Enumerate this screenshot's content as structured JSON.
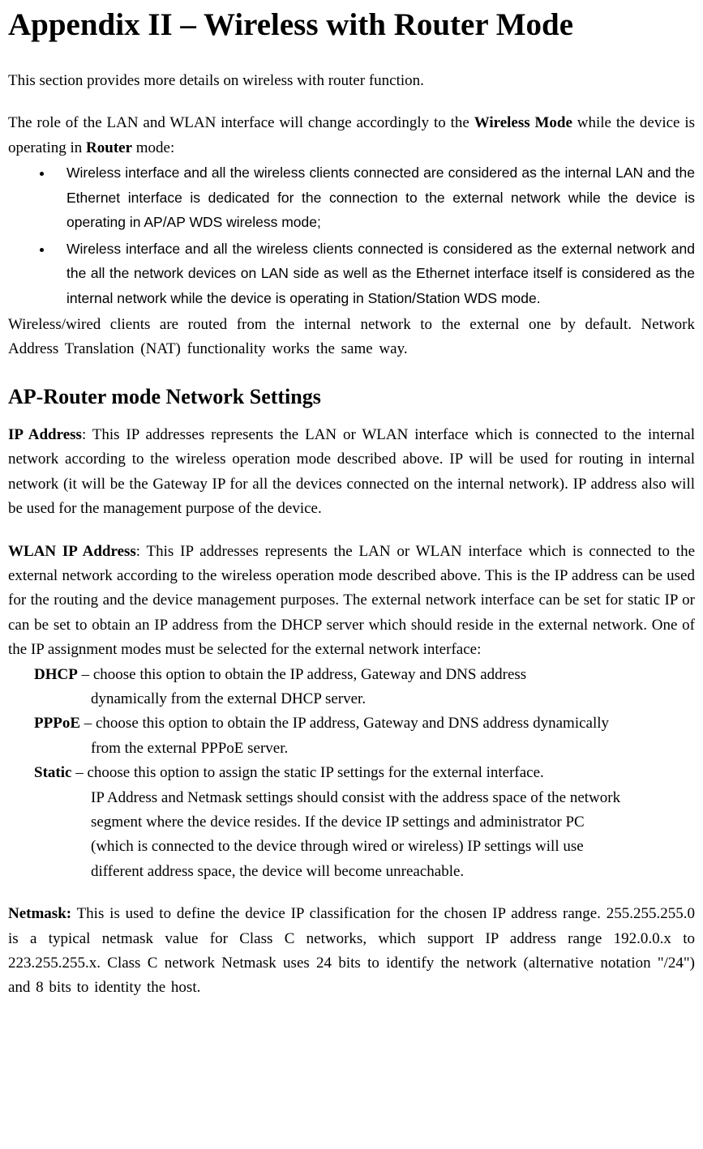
{
  "title": "Appendix II – Wireless with Router Mode",
  "intro": "This section provides more details on wireless with router function.",
  "role_p1_a": "The role of the LAN and WLAN interface will change accordingly to the ",
  "role_p1_bold1": "Wireless Mode",
  "role_p1_b": " while the device is operating in ",
  "role_p1_bold2": "Router",
  "role_p1_c": " mode:",
  "bullets": [
    "Wireless interface and all the wireless clients connected are considered as the internal LAN and the Ethernet interface is dedicated for the connection to the external network while the device is operating in AP/AP WDS wireless mode;",
    "Wireless interface and all the wireless clients connected is considered as the external network and the all the network devices on LAN side as well as the Ethernet interface itself is considered as the internal network while the device is operating in Station/Station WDS mode."
  ],
  "after_bullets": "Wireless/wired clients are routed from the internal network to the external one by default. Network Address Translation (NAT) functionality works the same way.",
  "h2": "AP-Router mode Network Settings",
  "ip_label": "IP Address",
  "ip_text": ": This IP addresses represents the LAN or WLAN interface which is connected to the internal network according to the wireless operation mode described above. IP will be used for routing in internal network (it will be the Gateway IP for all the devices connected on the internal network). IP address also will be used for the management purpose of the device.",
  "wlan_label": "WLAN IP Address",
  "wlan_text": ": This IP addresses represents the LAN or WLAN interface which is connected to the external network according to the wireless operation mode described above. This is the IP address can be used for the routing and the device management purposes. The external network interface can be set for static IP or can be set to obtain an IP address from the DHCP server which should reside in the external network. One of the IP assignment modes must be selected for the external network interface:",
  "dhcp_label": "DHCP",
  "dhcp_line1": " – choose this option to obtain the IP address, Gateway and DNS address",
  "dhcp_line2": "dynamically from the external DHCP server.",
  "pppoe_label": "PPPoE",
  "pppoe_line1": " – choose this option to obtain the IP address, Gateway and DNS address dynamically",
  "pppoe_line2": "from the external PPPoE server.",
  "static_label": "Static",
  "static_line1": " – choose this option to assign the static IP settings for the external interface.",
  "static_line2": "IP Address and Netmask settings should consist with the address space of the network",
  "static_line3": "segment where the device resides. If the device IP settings and administrator PC",
  "static_line4": "(which is connected to the device through wired or wireless) IP settings will use",
  "static_line5": "different address space, the device will become unreachable.",
  "netmask_label": "Netmask:",
  "netmask_text": " This is used to define the device IP classification for the chosen IP address range. 255.255.255.0 is a typical netmask value for Class C networks, which support IP address range 192.0.0.x to 223.255.255.x. Class C network Netmask uses 24 bits to identify the network (alternative notation \"/24\") and 8 bits to identity the host."
}
